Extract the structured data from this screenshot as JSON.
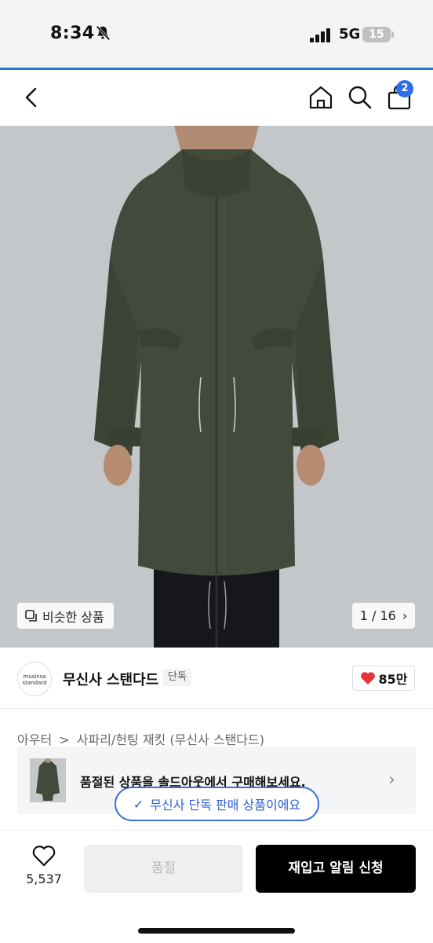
{
  "status_bar": {
    "time": "8:34",
    "network": "5G",
    "battery": "15"
  },
  "nav": {
    "cart_count": "2",
    "icons": [
      "back-chevron-icon",
      "home-icon",
      "search-icon",
      "cart-bag-icon"
    ]
  },
  "gallery": {
    "similar_label": "비슷한 상품",
    "counter": "1 / 16",
    "counter_chevron": "›"
  },
  "brand": {
    "logo_line1": "musinsa",
    "logo_line2": "standard",
    "name": "무신사 스탠다드",
    "tag": "단독",
    "likes": "85만"
  },
  "breadcrumb": {
    "category": "아우터",
    "separator": ">",
    "subcategory": "사파리/헌팅 재킷 (무신사 스탠다드)"
  },
  "soldout_banner": {
    "text": "품절된 상품을 솔드아웃에서 구매해보세요.",
    "chevron": "›"
  },
  "exclusive_pill": {
    "check": "✓",
    "text": "무신사 단독 판매 상품이에요"
  },
  "bottom_bar": {
    "wish_count": "5,537",
    "soldout_label": "품절",
    "restock_label": "재입고 알림 신청"
  },
  "colors": {
    "accent_blue": "#2e6de6",
    "heart_red": "#e8323a",
    "coat_green": "#434a3b"
  }
}
